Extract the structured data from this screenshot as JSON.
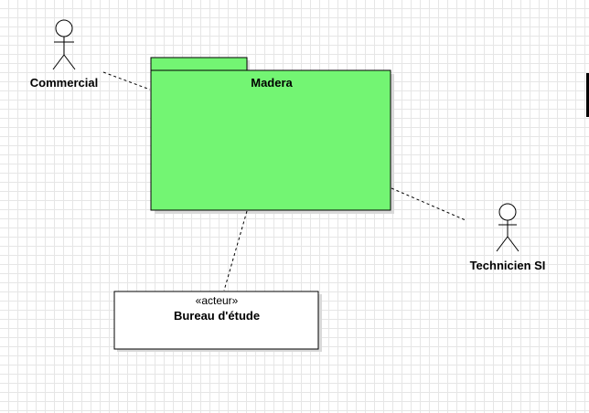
{
  "diagram": {
    "package": {
      "name": "Madera",
      "fill": "#73f573"
    },
    "actors": [
      {
        "name": "Commercial"
      },
      {
        "name": "Technicien SI"
      }
    ],
    "class_box": {
      "stereotype": "«acteur»",
      "name": "Bureau d'étude"
    },
    "colors": {
      "stroke": "#000000",
      "grid": "#e6e6e6",
      "background": "#ffffff"
    }
  }
}
